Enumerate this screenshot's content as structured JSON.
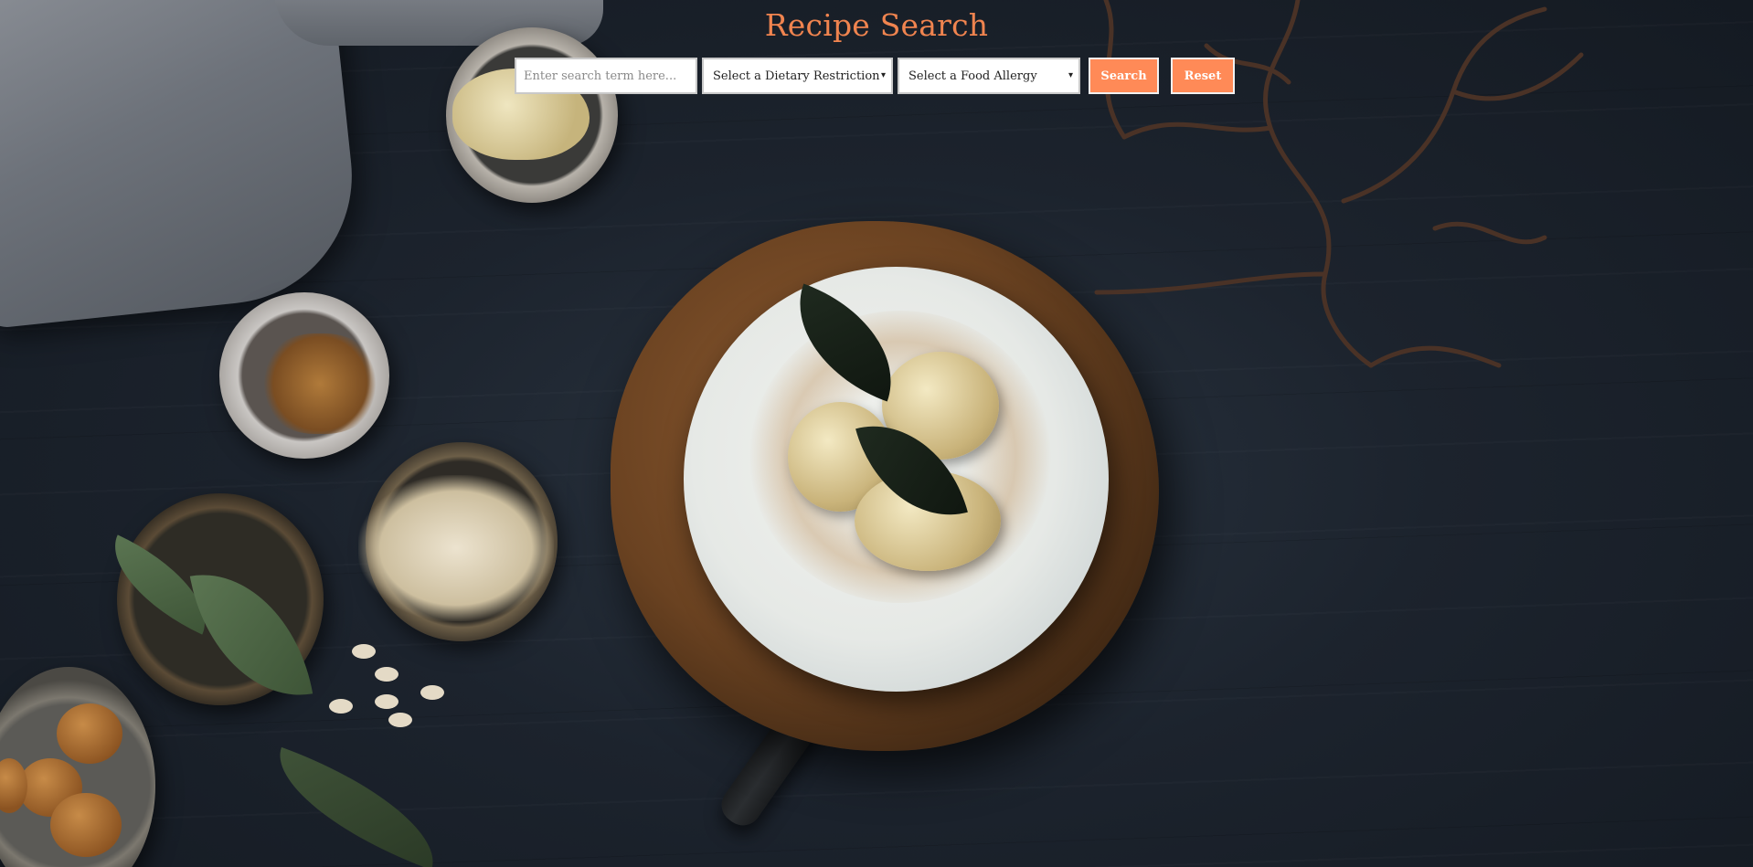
{
  "page": {
    "title": "Recipe Search"
  },
  "search": {
    "placeholder": "Enter search term here...",
    "value": ""
  },
  "filters": {
    "dietary": {
      "selected": "Select a Dietary Restriction"
    },
    "allergy": {
      "selected": "Select a Food Allergy"
    }
  },
  "buttons": {
    "search_label": "Search",
    "reset_label": "Reset"
  },
  "icons": {
    "dropdown_caret": "▾"
  },
  "colors": {
    "accent": "#ff8a57",
    "title": "#f0844f",
    "background": "#1c232d"
  },
  "background_image": "food-photo-cake-with-pears"
}
